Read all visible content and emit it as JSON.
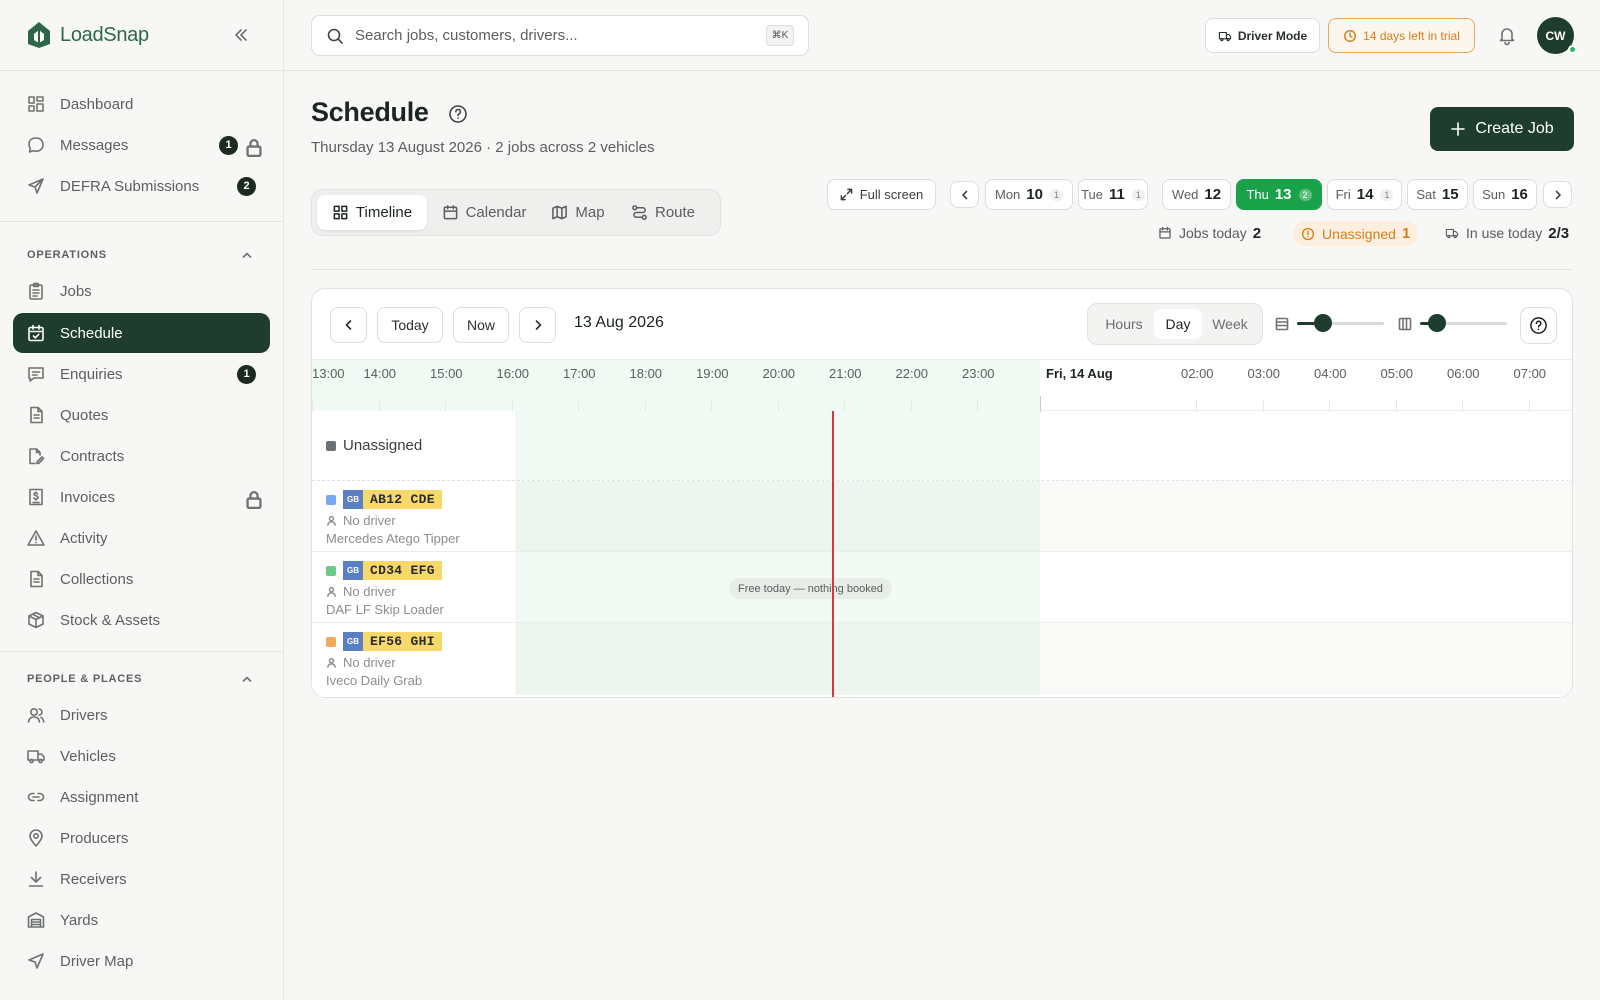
{
  "app": {
    "name": "LoadSnap"
  },
  "sidebar": {
    "items": [
      {
        "label": "Dashboard",
        "icon": "dashboard-icon"
      },
      {
        "label": "Messages",
        "icon": "message-icon",
        "badge": "1",
        "locked": true
      },
      {
        "label": "DEFRA Submissions",
        "icon": "send-icon",
        "badge": "2"
      }
    ],
    "sections": [
      {
        "title": "OPERATIONS",
        "items": [
          {
            "label": "Jobs",
            "icon": "clipboard-icon"
          },
          {
            "label": "Schedule",
            "icon": "calendar-check-icon",
            "active": true
          },
          {
            "label": "Enquiries",
            "icon": "enquiry-icon",
            "badge": "1"
          },
          {
            "label": "Quotes",
            "icon": "document-icon"
          },
          {
            "label": "Contracts",
            "icon": "contract-icon"
          },
          {
            "label": "Invoices",
            "icon": "invoice-icon",
            "locked": true
          },
          {
            "label": "Activity",
            "icon": "warning-icon"
          },
          {
            "label": "Collections",
            "icon": "collections-icon"
          },
          {
            "label": "Stock & Assets",
            "icon": "box-icon"
          }
        ]
      },
      {
        "title": "PEOPLE & PLACES",
        "items": [
          {
            "label": "Drivers",
            "icon": "users-icon"
          },
          {
            "label": "Vehicles",
            "icon": "truck-icon"
          },
          {
            "label": "Assignment",
            "icon": "link-icon"
          },
          {
            "label": "Producers",
            "icon": "map-pin-icon"
          },
          {
            "label": "Receivers",
            "icon": "download-icon"
          },
          {
            "label": "Yards",
            "icon": "warehouse-icon"
          },
          {
            "label": "Driver Map",
            "icon": "navigation-icon"
          }
        ]
      }
    ]
  },
  "topbar": {
    "search_placeholder": "Search jobs, customers, drivers...",
    "search_shortcut": "⌘K",
    "driver_mode": "Driver Mode",
    "trial": "14 days left in trial",
    "avatar_initials": "CW"
  },
  "header": {
    "title": "Schedule",
    "subtitle": "Thursday 13 August 2026 · 2 jobs across 2 vehicles",
    "create_job": "Create Job"
  },
  "view_tabs": [
    {
      "label": "Timeline",
      "icon": "grid-icon",
      "active": true
    },
    {
      "label": "Calendar",
      "icon": "calendar-icon"
    },
    {
      "label": "Map",
      "icon": "map-icon"
    },
    {
      "label": "Route",
      "icon": "route-icon"
    }
  ],
  "fullscreen": "Full screen",
  "days": [
    {
      "dow": "Mon",
      "num": "10",
      "count": "1"
    },
    {
      "dow": "Tue",
      "num": "11",
      "count": "1"
    },
    {
      "dow": "Wed",
      "num": "12",
      "count": ""
    },
    {
      "dow": "Thu",
      "num": "13",
      "count": "2",
      "active": true
    },
    {
      "dow": "Fri",
      "num": "14",
      "count": "1"
    },
    {
      "dow": "Sat",
      "num": "15",
      "count": ""
    },
    {
      "dow": "Sun",
      "num": "16",
      "count": ""
    }
  ],
  "stats": {
    "jobs_today_label": "Jobs today",
    "jobs_today_value": "2",
    "unassigned_label": "Unassigned",
    "unassigned_value": "1",
    "in_use_label": "In use today",
    "in_use_value": "2/3"
  },
  "timeline": {
    "today": "Today",
    "now": "Now",
    "date": "13 Aug 2026",
    "modes": [
      {
        "label": "Hours"
      },
      {
        "label": "Day",
        "active": true
      },
      {
        "label": "Week"
      }
    ],
    "row_zoom": 0.3,
    "col_zoom": 0.2,
    "hours_before": [
      "13:00",
      "14:00",
      "15:00",
      "16:00",
      "17:00",
      "18:00",
      "19:00",
      "20:00",
      "21:00",
      "22:00",
      "23:00"
    ],
    "next_day_label": "Fri, 14 Aug",
    "hours_after": [
      "02:00",
      "03:00",
      "04:00",
      "05:00",
      "06:00",
      "07:00"
    ],
    "unassigned_label": "Unassigned",
    "vehicles": [
      {
        "reg": "AB12 CDE",
        "driver": "No driver",
        "model": "Mercedes Atego Tipper",
        "color": "#7aa7f0"
      },
      {
        "reg": "CD34 EFG",
        "driver": "No driver",
        "model": "DAF LF Skip Loader",
        "color": "#6cc98a",
        "note": "Free today — nothing booked"
      },
      {
        "reg": "EF56 GHI",
        "driver": "No driver",
        "model": "Iveco Daily Grab",
        "color": "#f0aa5e"
      }
    ],
    "plate_country": "GB"
  }
}
